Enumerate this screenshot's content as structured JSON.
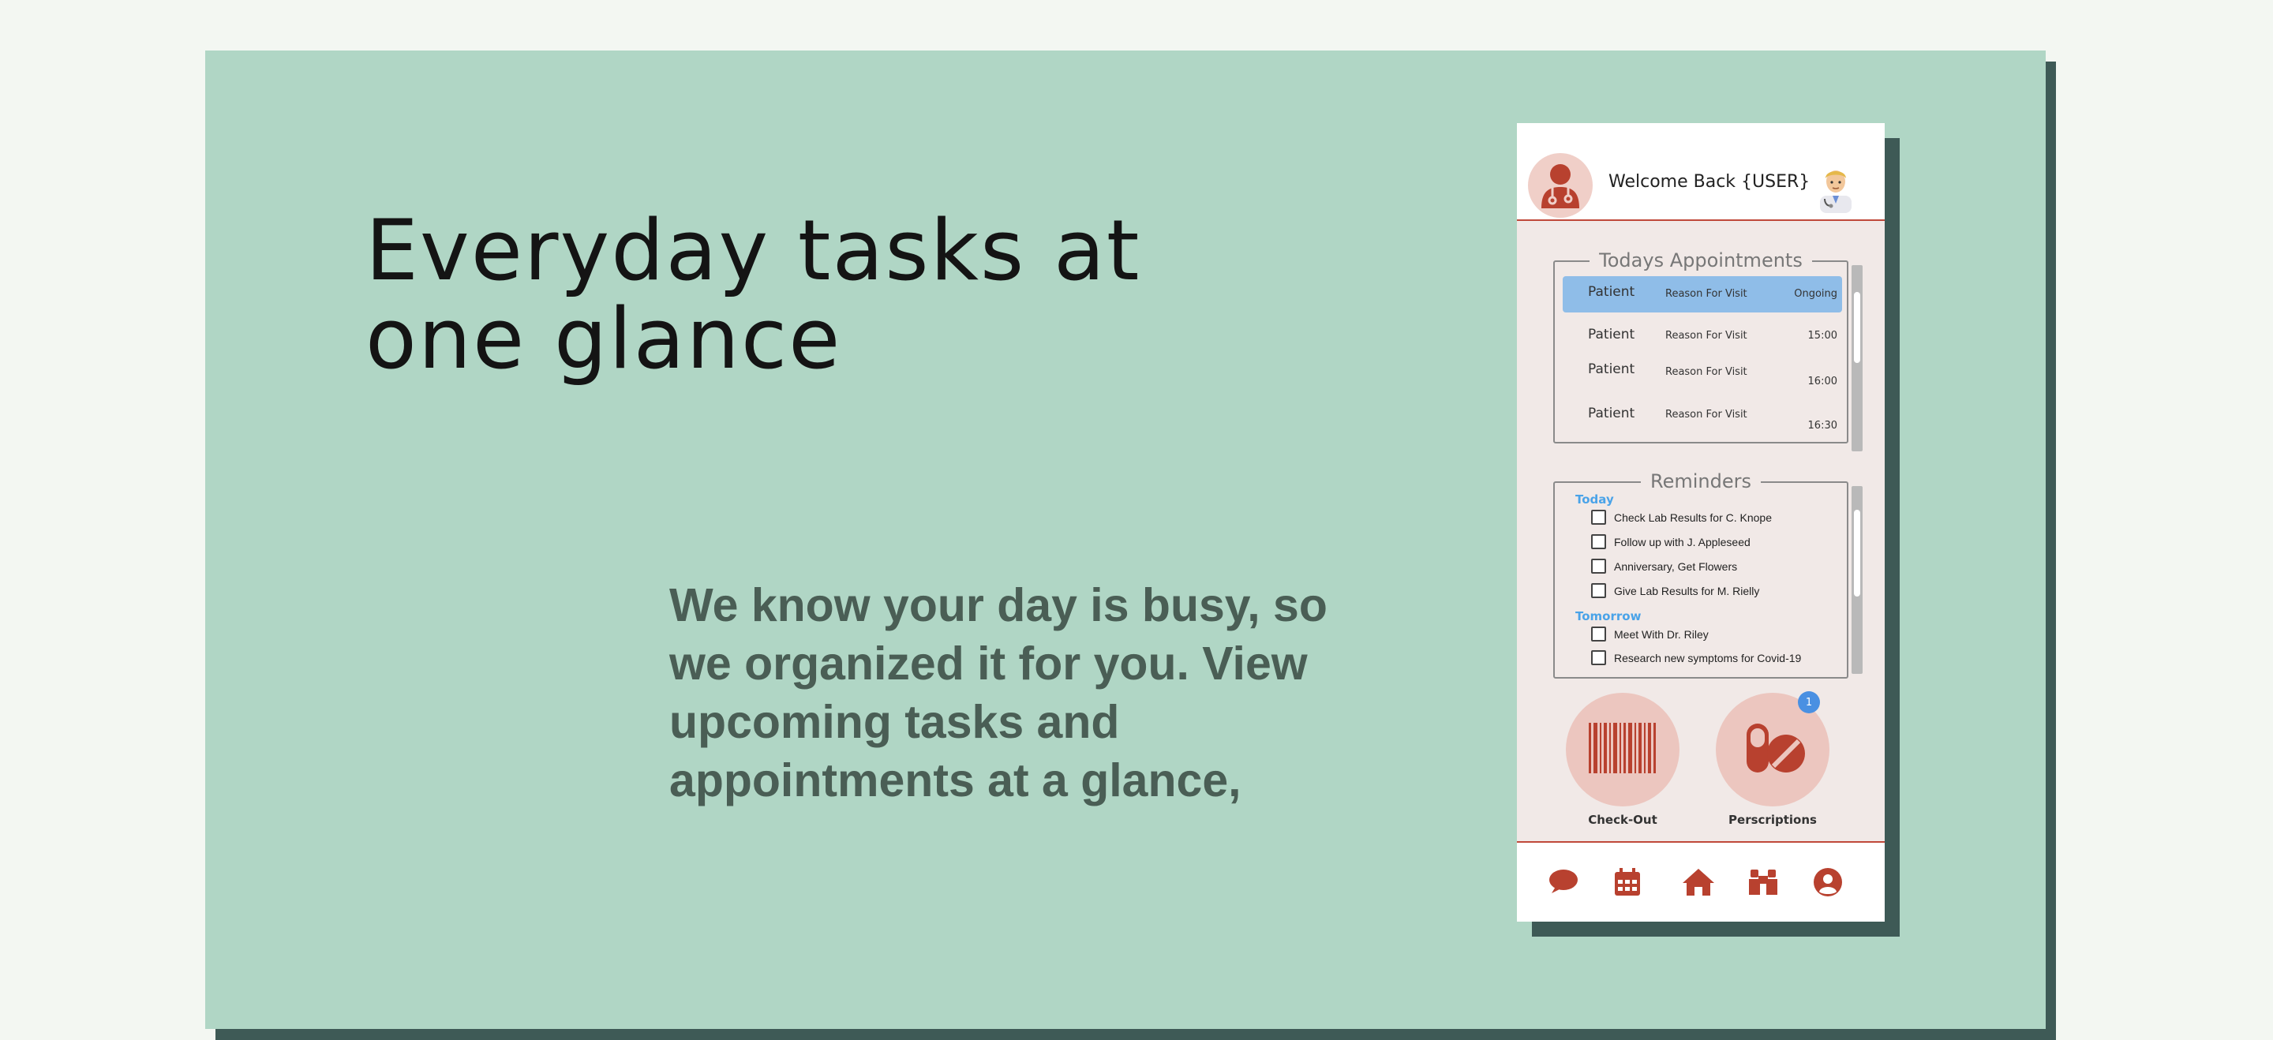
{
  "hero": {
    "headline_line1": "Everyday tasks at",
    "headline_line2": "one glance",
    "subtext_line1": "We know your day is busy, so",
    "subtext_line2": "we organized it for you. View",
    "subtext_line3": "upcoming tasks and",
    "subtext_line4": "appointments at a glance,"
  },
  "phone": {
    "header": {
      "welcome": "Welcome Back {USER}",
      "doctor_icon": "doctor-icon",
      "user_avatar_icon": "doctor-emoji-avatar"
    },
    "appointments": {
      "title": "Todays Appointments",
      "rows": [
        {
          "patient": "Patient",
          "reason": "Reason For Visit",
          "time": "Ongoing",
          "active": true
        },
        {
          "patient": "Patient",
          "reason": "Reason For Visit",
          "time": "15:00",
          "active": false
        },
        {
          "patient": "Patient",
          "reason": "Reason For Visit",
          "time": "16:00",
          "active": false
        },
        {
          "patient": "Patient",
          "reason": "Reason For Visit",
          "time": "16:30",
          "active": false
        }
      ]
    },
    "reminders": {
      "title": "Reminders",
      "today_label": "Today",
      "today_items": [
        "Check Lab Results for C. Knope",
        "Follow up with J. Appleseed",
        "Anniversary, Get Flowers",
        "Give Lab Results for M. Rielly"
      ],
      "tomorrow_label": "Tomorrow",
      "tomorrow_items": [
        "Meet With Dr. Riley",
        "Research new symptoms for Covid-19"
      ]
    },
    "actions": {
      "checkout_label": "Check-Out",
      "checkout_icon": "barcode-icon",
      "prescriptions_label": "Perscriptions",
      "prescriptions_icon": "pills-icon",
      "prescriptions_badge": "1"
    },
    "nav": {
      "items": [
        "chat-icon",
        "calendar-icon",
        "home-icon",
        "binoculars-icon",
        "profile-icon"
      ]
    }
  },
  "colors": {
    "panel_bg": "#b0d6c5",
    "shadow": "#3e5a56",
    "brand_red": "#c0493a",
    "highlight_blue": "#8fbde8",
    "group_blue": "#4aa3e8"
  }
}
